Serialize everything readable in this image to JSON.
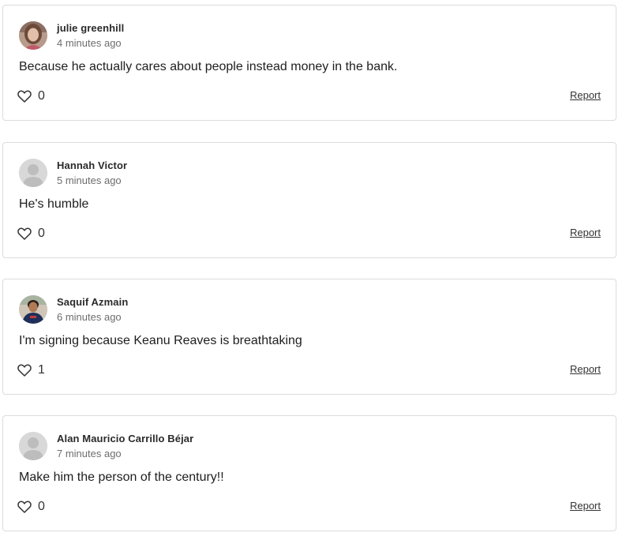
{
  "comments": [
    {
      "author": "julie greenhill",
      "time": "4 minutes ago",
      "text": "Because he actually cares about people instead money in the bank.",
      "likes": "0",
      "report_label": "Report",
      "avatar": "photo-avatar"
    },
    {
      "author": "Hannah Victor",
      "time": "5 minutes ago",
      "text": "He's humble",
      "likes": "0",
      "report_label": "Report",
      "avatar": "default-avatar"
    },
    {
      "author": "Saquif Azmain",
      "time": "6 minutes ago",
      "text": "I'm signing because Keanu Reaves is breathtaking",
      "likes": "1",
      "report_label": "Report",
      "avatar": "photo-avatar"
    },
    {
      "author": "Alan Mauricio Carrillo Béjar",
      "time": "7 minutes ago",
      "text": "Make him the person of the century!!",
      "likes": "0",
      "report_label": "Report",
      "avatar": "default-avatar"
    }
  ],
  "icons": {
    "like": "heart-outline-icon"
  },
  "colors": {
    "card_border": "#dcdcdc",
    "text": "#1e1e1e",
    "muted": "#6d6d6d"
  }
}
